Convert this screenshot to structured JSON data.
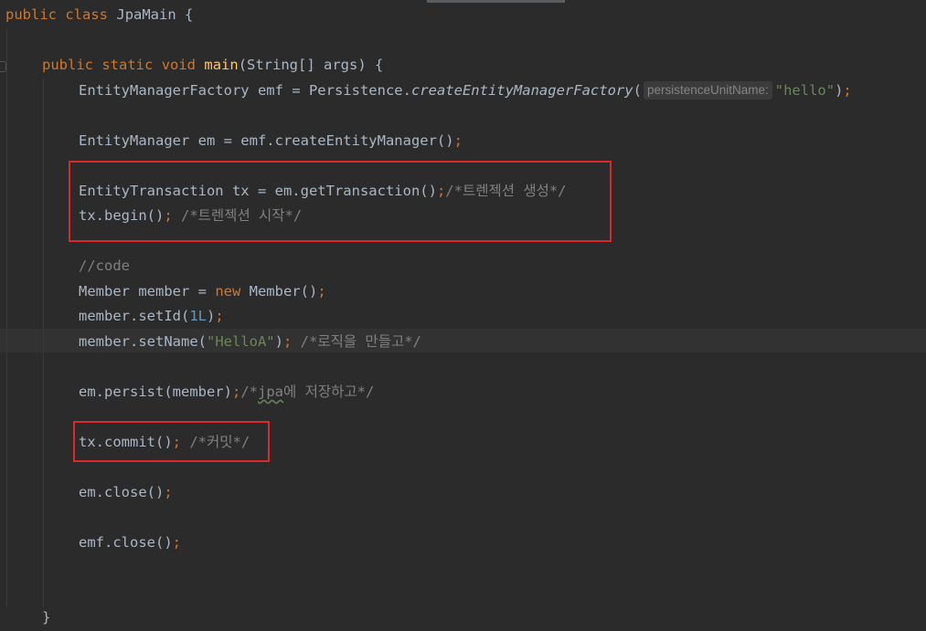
{
  "editor": {
    "lines": {
      "l1": {
        "kw_public": "public",
        "kw_class": "class",
        "class_name": "JpaMain",
        "brace": "{"
      },
      "l2": {
        "kw_public": "public",
        "kw_static": "static",
        "kw_void": "void",
        "method": "main",
        "params": "(String[] args) {"
      },
      "l3": {
        "decl": "EntityManagerFactory emf = Persistence.",
        "call": "createEntityManagerFactory",
        "open": "(",
        "hint": "persistenceUnitName:",
        "arg": "\"hello\"",
        "close": ")",
        "semi": ";"
      },
      "l4": {
        "code": "EntityManager em = emf.createEntityManager()",
        "semi": ";"
      },
      "l5": {
        "code": "EntityTransaction tx = em.getTransaction()",
        "semi": ";",
        "comment": "/*트렌젝션 생성*/"
      },
      "l6": {
        "code": "tx.begin()",
        "semi": ";",
        "comment": " /*트렌젝션 시작*/"
      },
      "l7": {
        "comment": "//code"
      },
      "l8": {
        "code1": "Member member = ",
        "kw_new": "new",
        "code2": " Member()",
        "semi": ";"
      },
      "l9": {
        "code1": "member.setId(",
        "num": "1L",
        "code2": ")",
        "semi": ";"
      },
      "l10": {
        "code1": "member.setName(",
        "str": "\"HelloA\"",
        "code2": ")",
        "semi": ";",
        "comment": " /*로직을 만들고*/"
      },
      "l11": {
        "code": "em.persist(member)",
        "semi": ";",
        "comment_a": "/*",
        "comment_b": "jpa",
        "comment_c": "에 저장하고*/"
      },
      "l12": {
        "code": "tx.commit()",
        "semi": ";",
        "comment": " /*커밋*/"
      },
      "l13": {
        "code": "em.close()",
        "semi": ";"
      },
      "l14": {
        "code": "emf.close()",
        "semi": ";"
      },
      "l15": {
        "brace": "}"
      }
    }
  },
  "colors": {
    "background": "#2b2b2b",
    "keyword": "#cc7832",
    "method_decl": "#ffc66d",
    "string": "#6a8759",
    "number": "#6897bb",
    "comment": "#808080",
    "default_text": "#a9b7c6",
    "highlight_box": "#d9292b"
  }
}
